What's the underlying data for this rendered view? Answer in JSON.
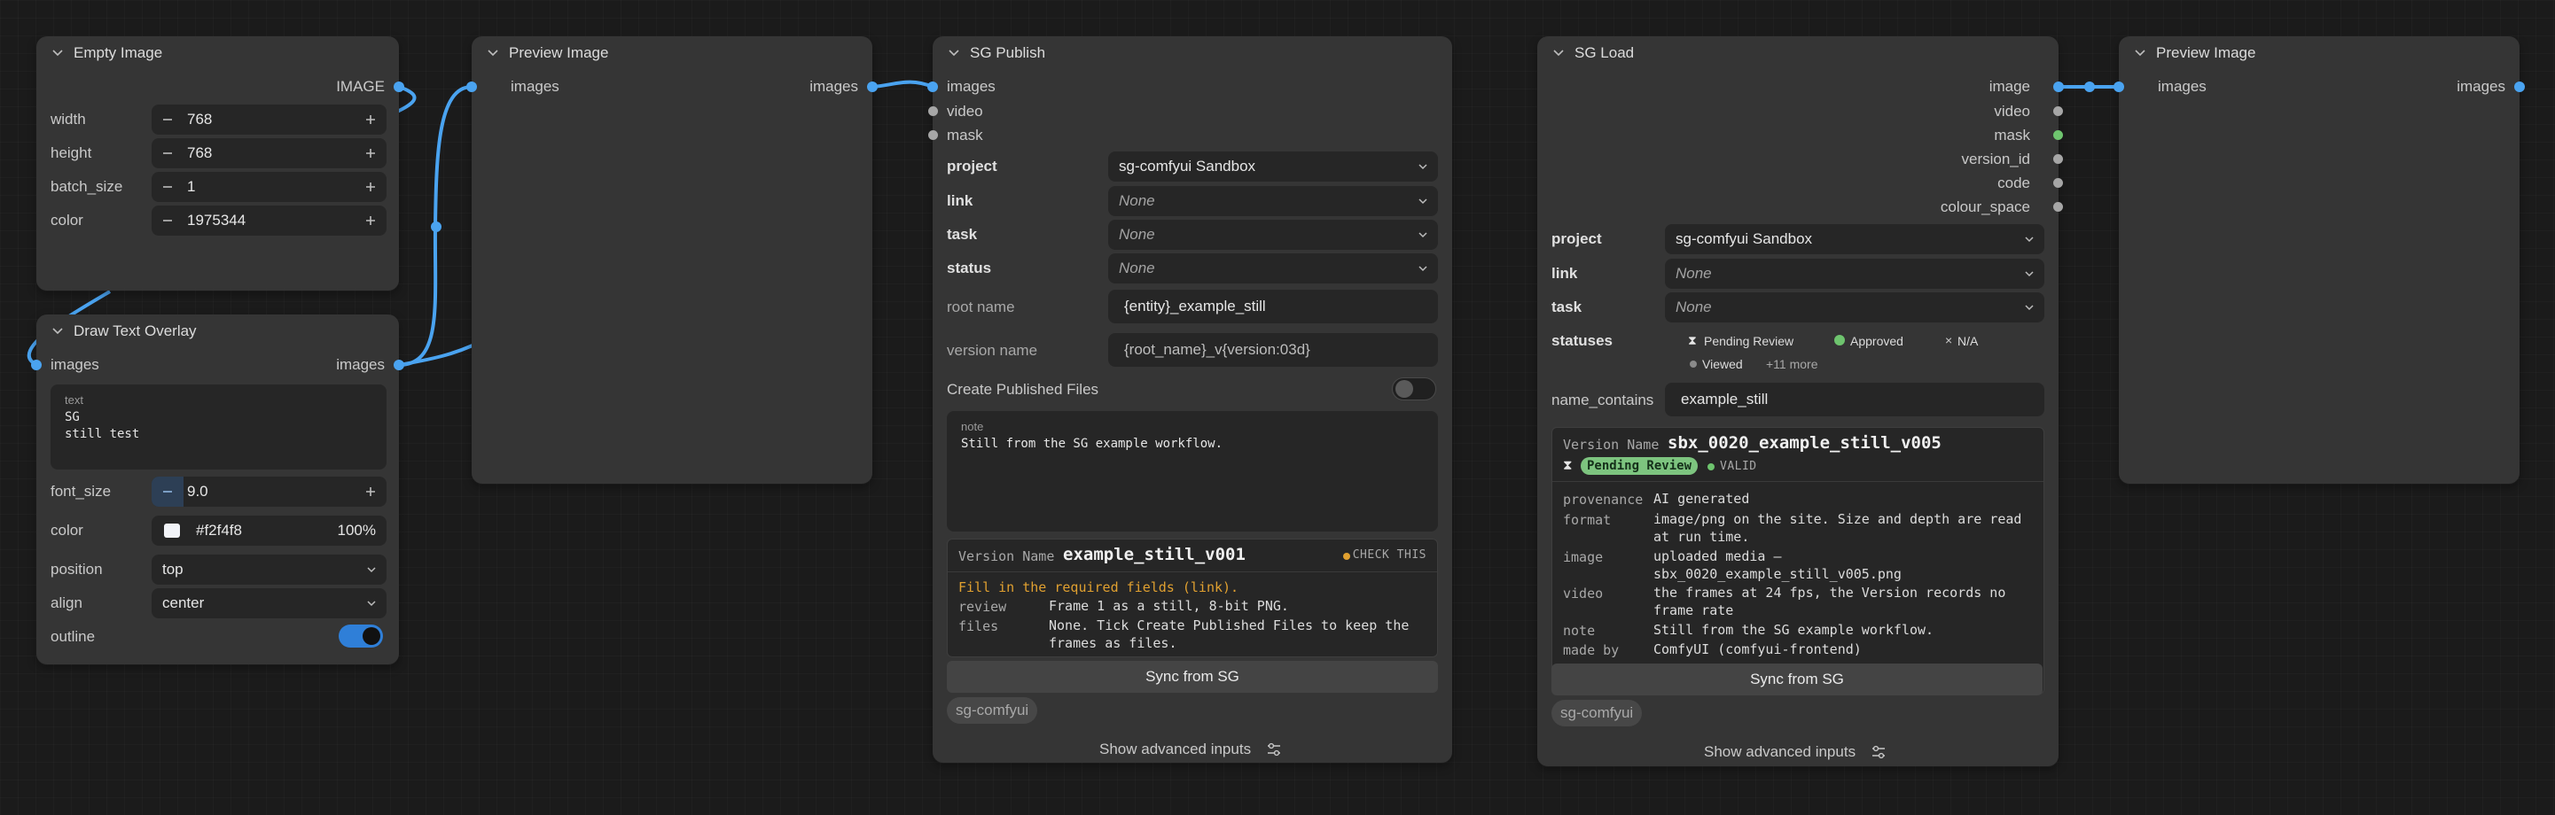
{
  "colors": {
    "wire": "#4aa3f0",
    "canvas": "#1b1b1b",
    "node": "#353535",
    "widget": "#262626",
    "toggle_on": "#2f7fd8",
    "toggle_off": "#202020",
    "warning": "#e0a030",
    "valid": "#6ec46e",
    "pending_bg": "#7dc47f"
  },
  "empty_image": {
    "title": "Empty Image",
    "output_label": "IMAGE",
    "widgets": [
      {
        "label": "width",
        "value": "768"
      },
      {
        "label": "height",
        "value": "768"
      },
      {
        "label": "batch_size",
        "value": "1"
      },
      {
        "label": "color",
        "value": "1975344"
      }
    ]
  },
  "draw_text": {
    "title": "Draw Text Overlay",
    "input_label": "images",
    "output_label": "images",
    "text_label": "text",
    "text_value": "SG\nstill test",
    "font_size_label": "font_size",
    "font_size_value": "9.0",
    "color_label": "color",
    "color_hex": "#f2f4f8",
    "color_opacity": "100%",
    "position_label": "position",
    "position_value": "top",
    "align_label": "align",
    "align_value": "center",
    "outline_label": "outline",
    "outline_on": true
  },
  "preview1": {
    "title": "Preview Image",
    "input_label": "images",
    "output_label": "images"
  },
  "publish": {
    "title": "SG Publish",
    "inputs": [
      "images",
      "video",
      "mask"
    ],
    "fields": [
      {
        "label": "project",
        "value": "sg-comfyui Sandbox",
        "none": false
      },
      {
        "label": "link",
        "value": "None",
        "none": true
      },
      {
        "label": "task",
        "value": "None",
        "none": true
      },
      {
        "label": "status",
        "value": "None",
        "none": true
      }
    ],
    "root_name_label": "root name",
    "root_name_value": "{entity}_example_still",
    "version_name_label": "version name",
    "version_name_value": "{root_name}_v{version:03d}",
    "create_files_label": "Create Published Files",
    "create_files_on": false,
    "note_label": "note",
    "note_value": "Still from the SG example workflow.",
    "version_header": "Version Name",
    "version_value": "example_still_v001",
    "check_label": "CHECK THIS",
    "warning": "Fill in the required fields (link).",
    "rows": [
      {
        "key": "review",
        "value": "Frame 1 as a still, 8-bit PNG."
      },
      {
        "key": "files",
        "value": "None. Tick Create Published Files to keep the frames as files."
      }
    ],
    "sync_label": "Sync from SG",
    "chip_label": "sg-comfyui",
    "advanced_label": "Show advanced inputs"
  },
  "load": {
    "title": "SG Load",
    "outputs": [
      "image",
      "video",
      "mask",
      "version_id",
      "code",
      "colour_space"
    ],
    "fields": [
      {
        "label": "project",
        "value": "sg-comfyui Sandbox",
        "none": false
      },
      {
        "label": "link",
        "value": "None",
        "none": true
      },
      {
        "label": "task",
        "value": "None",
        "none": true
      }
    ],
    "statuses_label": "statuses",
    "statuses": [
      {
        "label": "Pending Review",
        "icon": "hourglass-icon"
      },
      {
        "label": "Approved",
        "icon": "check-circle-icon"
      },
      {
        "label": "N/A",
        "icon": "x-icon"
      },
      {
        "label": "Viewed",
        "icon": "dot-icon"
      }
    ],
    "more_label": "+11 more",
    "name_contains_label": "name_contains",
    "name_contains_value": "example_still",
    "version_header": "Version Name",
    "version_value": "sbx_0020_example_still_v005",
    "status_badge": "Pending Review",
    "valid_label": "VALID",
    "rows": [
      {
        "key": "provenance",
        "value": "AI generated"
      },
      {
        "key": "format",
        "value": "image/png on the site. Size and depth are read at run time."
      },
      {
        "key": "image",
        "value": "uploaded media — sbx_0020_example_still_v005.png"
      },
      {
        "key": "video",
        "value": "the frames at 24 fps, the Version records no frame rate"
      },
      {
        "key": "note",
        "value": "Still from the SG example workflow."
      },
      {
        "key": "made by",
        "value": "ComfyUI (comfyui-frontend)"
      }
    ],
    "sync_label": "Sync from SG",
    "chip_label": "sg-comfyui",
    "advanced_label": "Show advanced inputs"
  },
  "preview2": {
    "title": "Preview Image",
    "input_label": "images",
    "output_label": "images"
  }
}
